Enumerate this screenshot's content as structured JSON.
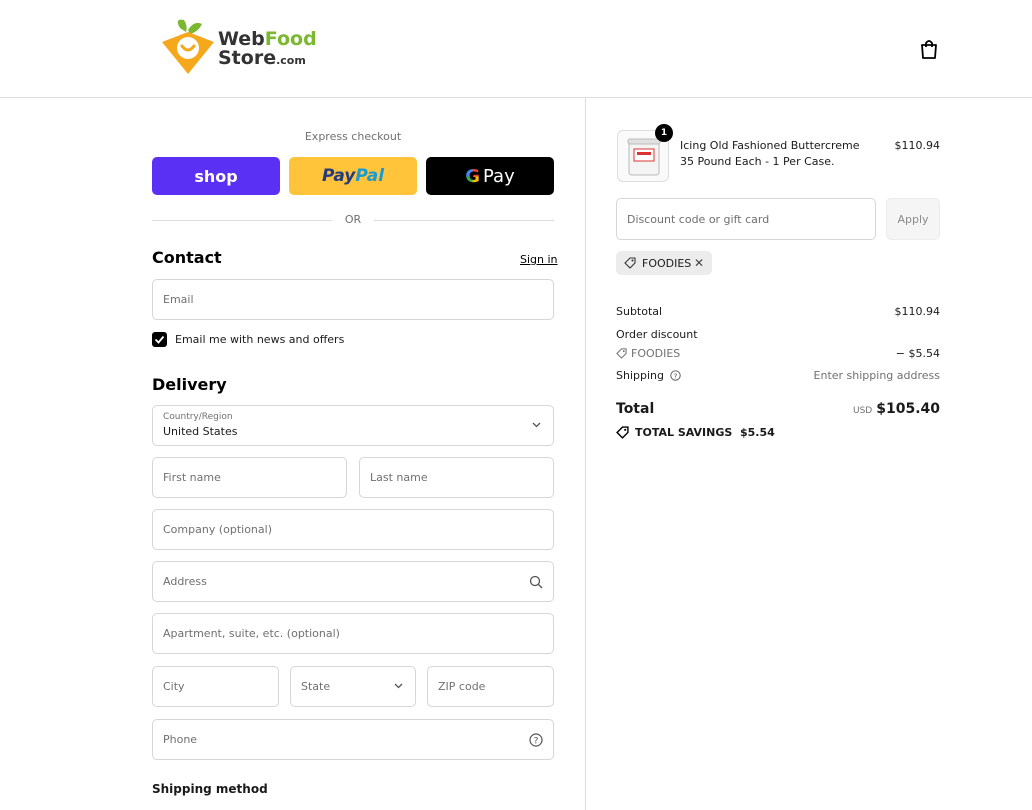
{
  "header": {
    "logo_line1_a": "Web",
    "logo_line1_b": "Food",
    "logo_line2_a": "Store",
    "logo_line2_b": ".com"
  },
  "express": {
    "label": "Express checkout",
    "shop_label": "shop",
    "paypal_a": "Pay",
    "paypal_b": "Pal",
    "gpay_g": "G",
    "gpay_label": "Pay",
    "or": "OR"
  },
  "contact": {
    "heading": "Contact",
    "sign_in": "Sign in",
    "email_placeholder": "Email",
    "newsletter_label": "Email me with news and offers"
  },
  "delivery": {
    "heading": "Delivery",
    "country_label": "Country/Region",
    "country_value": "United States",
    "first_name": "First name",
    "last_name": "Last name",
    "company": "Company (optional)",
    "address": "Address",
    "apartment": "Apartment, suite, etc. (optional)",
    "city": "City",
    "state": "State",
    "zip": "ZIP code",
    "phone": "Phone"
  },
  "shipping_method": {
    "heading": "Shipping method"
  },
  "order": {
    "quantity": "1",
    "product_name": "Icing Old Fashioned Buttercreme 35 Pound Each - 1 Per Case.",
    "product_price": "$110.94",
    "discount_placeholder": "Discount code or gift card",
    "apply": "Apply",
    "applied_code": "FOODIES",
    "subtotal_label": "Subtotal",
    "subtotal_value": "$110.94",
    "order_discount_label": "Order discount",
    "discount_code": "FOODIES",
    "discount_value": "− $5.54",
    "shipping_label": "Shipping",
    "shipping_value": "Enter shipping address",
    "total_label": "Total",
    "currency": "USD",
    "total_value": "$105.40",
    "savings_label": "TOTAL SAVINGS",
    "savings_value": "$5.54"
  },
  "colors": {
    "shop": "#5a31f4",
    "paypal": "#ffc439",
    "gpay": "#000000",
    "logo_orange": "#f6a81c",
    "logo_green": "#7cb82f"
  }
}
